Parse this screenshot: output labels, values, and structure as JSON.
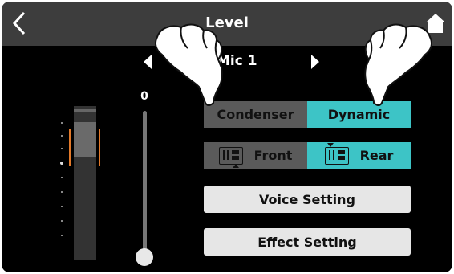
{
  "header": {
    "title": "Level",
    "back_icon": "chevron-left-icon",
    "home_icon": "home-icon"
  },
  "channel_selector": {
    "label": "Mic 1",
    "prev_icon": "arrow-left-icon",
    "next_icon": "arrow-right-icon"
  },
  "fader": {
    "value": "0"
  },
  "mic_type": {
    "options": [
      "Condenser",
      "Dynamic"
    ],
    "selected": "Dynamic"
  },
  "mic_position": {
    "options": [
      "Front",
      "Rear"
    ],
    "selected": "Rear"
  },
  "buttons": {
    "voice_setting": "Voice Setting",
    "effect_setting": "Effect Setting"
  },
  "colors": {
    "accent": "#3dc4c6",
    "inactive": "#5a5a5a",
    "header": "#3d3d3d",
    "peak": "#e47a2a"
  }
}
